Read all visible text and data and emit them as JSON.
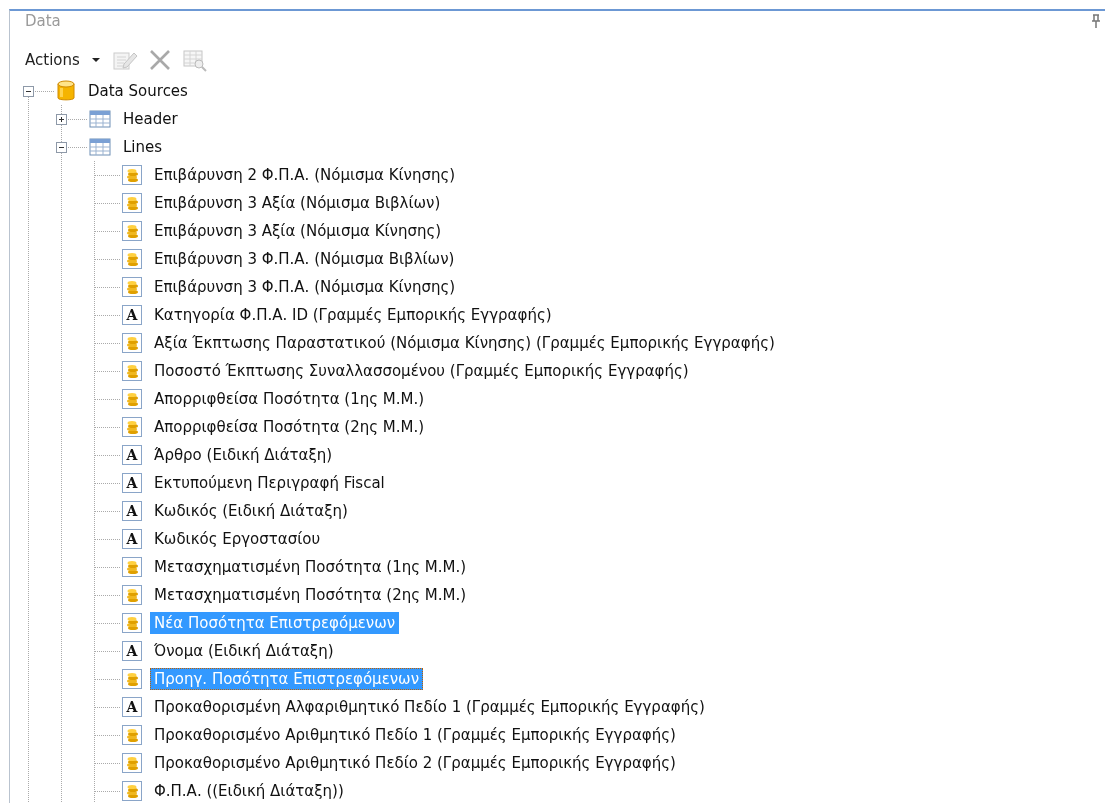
{
  "panel": {
    "title": "Data"
  },
  "toolbar": {
    "actions_label": "Actions"
  },
  "tree": [
    {
      "label": "Data Sources",
      "kind": "database",
      "expanded": true,
      "selected": false,
      "focused": false,
      "children": [
        {
          "label": "Header",
          "kind": "table",
          "expanded": false,
          "selected": false,
          "focused": false
        },
        {
          "label": "Lines",
          "kind": "table",
          "expanded": true,
          "selected": false,
          "focused": false,
          "children": [
            {
              "label": "Επιβάρυνση 2 Φ.Π.Α. (Νόμισμα Κίνησης)",
              "kind": "numeric",
              "selected": false,
              "focused": false
            },
            {
              "label": "Επιβάρυνση 3 Αξία (Νόμισμα Βιβλίων)",
              "kind": "numeric",
              "selected": false,
              "focused": false
            },
            {
              "label": "Επιβάρυνση 3 Αξία (Νόμισμα Κίνησης)",
              "kind": "numeric",
              "selected": false,
              "focused": false
            },
            {
              "label": "Επιβάρυνση 3 Φ.Π.Α. (Νόμισμα Βιβλίων)",
              "kind": "numeric",
              "selected": false,
              "focused": false
            },
            {
              "label": "Επιβάρυνση 3 Φ.Π.Α. (Νόμισμα Κίνησης)",
              "kind": "numeric",
              "selected": false,
              "focused": false
            },
            {
              "label": "Κατηγορία Φ.Π.Α. ID  (Γραμμές Εμπορικής Εγγραφής)",
              "kind": "text",
              "glyph": "A",
              "selected": false,
              "focused": false
            },
            {
              "label": "Αξία Έκπτωσης Παραστατικού (Νόμισμα Κίνησης) (Γραμμές Εμπορικής Εγγραφής)",
              "kind": "numeric",
              "selected": false,
              "focused": false
            },
            {
              "label": "Ποσοστό Έκπτωσης Συναλλασσομένου (Γραμμές Εμπορικής Εγγραφής)",
              "kind": "numeric",
              "selected": false,
              "focused": false
            },
            {
              "label": "Απορριφθείσα Ποσότητα (1ης Μ.Μ.)",
              "kind": "numeric",
              "selected": false,
              "focused": false
            },
            {
              "label": "Απορριφθείσα Ποσότητα (2ης Μ.Μ.)",
              "kind": "numeric",
              "selected": false,
              "focused": false
            },
            {
              "label": "Άρθρο (Ειδική Διάταξη)",
              "kind": "text",
              "glyph": "A",
              "selected": false,
              "focused": false
            },
            {
              "label": "Εκτυπούμενη Περιγραφή Fiscal",
              "kind": "text",
              "glyph": "A",
              "selected": false,
              "focused": false
            },
            {
              "label": "Κωδικός (Ειδική Διάταξη)",
              "kind": "text",
              "glyph": "A",
              "selected": false,
              "focused": false
            },
            {
              "label": "Κωδικός Εργοστασίου",
              "kind": "text",
              "glyph": "A",
              "selected": false,
              "focused": false
            },
            {
              "label": "Μετασχηματισμένη Ποσότητα (1ης Μ.Μ.)",
              "kind": "numeric",
              "selected": false,
              "focused": false
            },
            {
              "label": "Μετασχηματισμένη Ποσότητα (2ης Μ.Μ.)",
              "kind": "numeric",
              "selected": false,
              "focused": false
            },
            {
              "label": "Νέα Ποσότητα Επιστρεφόμενων",
              "kind": "numeric",
              "selected": true,
              "focused": false
            },
            {
              "label": "Όνομα (Ειδική Διάταξη)",
              "kind": "text",
              "glyph": "A",
              "selected": false,
              "focused": false
            },
            {
              "label": "Προηγ. Ποσότητα Επιστρεφόμενων",
              "kind": "numeric",
              "selected": true,
              "focused": true
            },
            {
              "label": "Προκαθορισμένη Αλφαριθμητικό Πεδίο 1 (Γραμμές Εμπορικής Εγγραφής)",
              "kind": "text",
              "glyph": "A",
              "selected": false,
              "focused": false
            },
            {
              "label": "Προκαθορισμένο Αριθμητικό Πεδίο 1 (Γραμμές Εμπορικής Εγγραφής)",
              "kind": "numeric",
              "selected": false,
              "focused": false
            },
            {
              "label": "Προκαθορισμένο Αριθμητικό Πεδίο 2 (Γραμμές Εμπορικής Εγγραφής)",
              "kind": "numeric",
              "selected": false,
              "focused": false
            },
            {
              "label": "Φ.Π.Α. ((Ειδική Διάταξη))",
              "kind": "numeric",
              "selected": false,
              "focused": false
            }
          ]
        }
      ]
    }
  ]
}
